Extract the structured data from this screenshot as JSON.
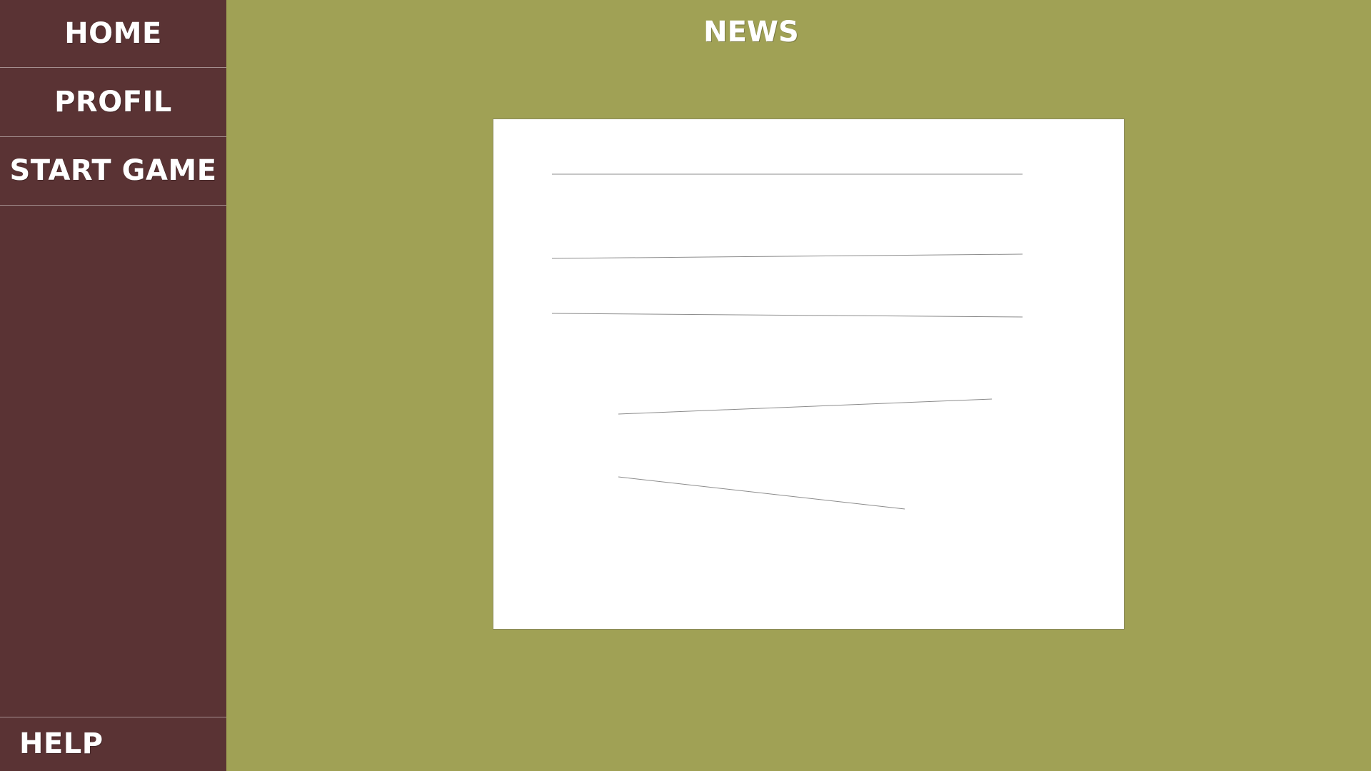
{
  "sidebar": {
    "items": [
      {
        "label": "HOME"
      },
      {
        "label": "PROFIL"
      },
      {
        "label": "START GAME"
      }
    ],
    "help": {
      "label": "HELP"
    }
  },
  "main": {
    "title": "NEWS"
  },
  "colors": {
    "background": "#a0a155",
    "sidebar": "#5a3334",
    "panel": "#ffffff",
    "text": "#ffffff"
  }
}
